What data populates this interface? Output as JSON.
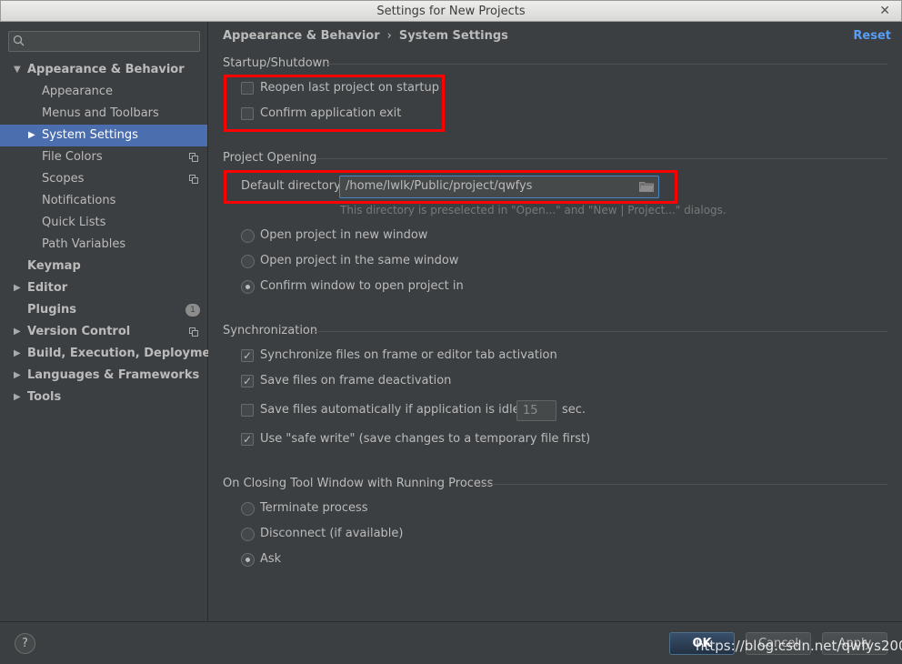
{
  "window": {
    "title": "Settings for New Projects"
  },
  "search": {
    "placeholder": ""
  },
  "sidebar": {
    "items": [
      {
        "label": "Appearance & Behavior",
        "icon": "triangle-down"
      },
      {
        "label": "Appearance"
      },
      {
        "label": "Menus and Toolbars"
      },
      {
        "label": "System Settings",
        "icon": "triangle-right",
        "selected": true
      },
      {
        "label": "File Colors",
        "icon": "copy-icon"
      },
      {
        "label": "Scopes",
        "icon": "copy-icon"
      },
      {
        "label": "Notifications"
      },
      {
        "label": "Quick Lists"
      },
      {
        "label": "Path Variables"
      },
      {
        "label": "Keymap"
      },
      {
        "label": "Editor",
        "icon": "triangle-right"
      },
      {
        "label": "Plugins",
        "badge": "1"
      },
      {
        "label": "Version Control",
        "icon": "triangle-right"
      },
      {
        "label": "Build, Execution, Deployment",
        "icon": "triangle-right"
      },
      {
        "label": "Languages & Frameworks",
        "icon": "triangle-right"
      },
      {
        "label": "Tools",
        "icon": "triangle-right"
      }
    ]
  },
  "breadcrumb": {
    "parent": "Appearance & Behavior",
    "separator": "›",
    "current": "System Settings"
  },
  "reset_label": "Reset",
  "startup": {
    "title": "Startup/Shutdown",
    "reopen_label": "Reopen last project on startup",
    "reopen_checked": false,
    "confirm_exit_label": "Confirm application exit",
    "confirm_exit_checked": false
  },
  "project_opening": {
    "title": "Project Opening",
    "default_dir_label": "Default directory:",
    "default_dir_value": "/home/lwlk/Public/project/qwfys",
    "hint": "This directory is preselected in \"Open...\" and \"New | Project...\" dialogs.",
    "options": [
      {
        "label": "Open project in new window",
        "selected": false
      },
      {
        "label": "Open project in the same window",
        "selected": false
      },
      {
        "label": "Confirm window to open project in",
        "selected": true
      }
    ]
  },
  "synchronization": {
    "title": "Synchronization",
    "sync_label": "Synchronize files on frame or editor tab activation",
    "sync_checked": true,
    "save_deactivation_label": "Save files on frame deactivation",
    "save_deactivation_checked": true,
    "save_idle_label": "Save files automatically if application is idle for",
    "save_idle_checked": false,
    "idle_seconds": "15",
    "idle_unit": "sec.",
    "safe_write_label": "Use \"safe write\" (save changes to a temporary file first)",
    "safe_write_checked": true
  },
  "closing": {
    "title": "On Closing Tool Window with Running Process",
    "options": [
      {
        "label": "Terminate process",
        "selected": false
      },
      {
        "label": "Disconnect (if available)",
        "selected": false
      },
      {
        "label": "Ask",
        "selected": true
      }
    ]
  },
  "buttons": {
    "help": "?",
    "ok": "OK",
    "cancel": "Cancel",
    "apply": "Apply"
  },
  "watermark": "https://blog.csdn.net/qwfys200",
  "colors": {
    "accent": "#4b6eaf",
    "link": "#589df6",
    "highlight_box": "#ff0000",
    "background": "#3c3f41"
  }
}
